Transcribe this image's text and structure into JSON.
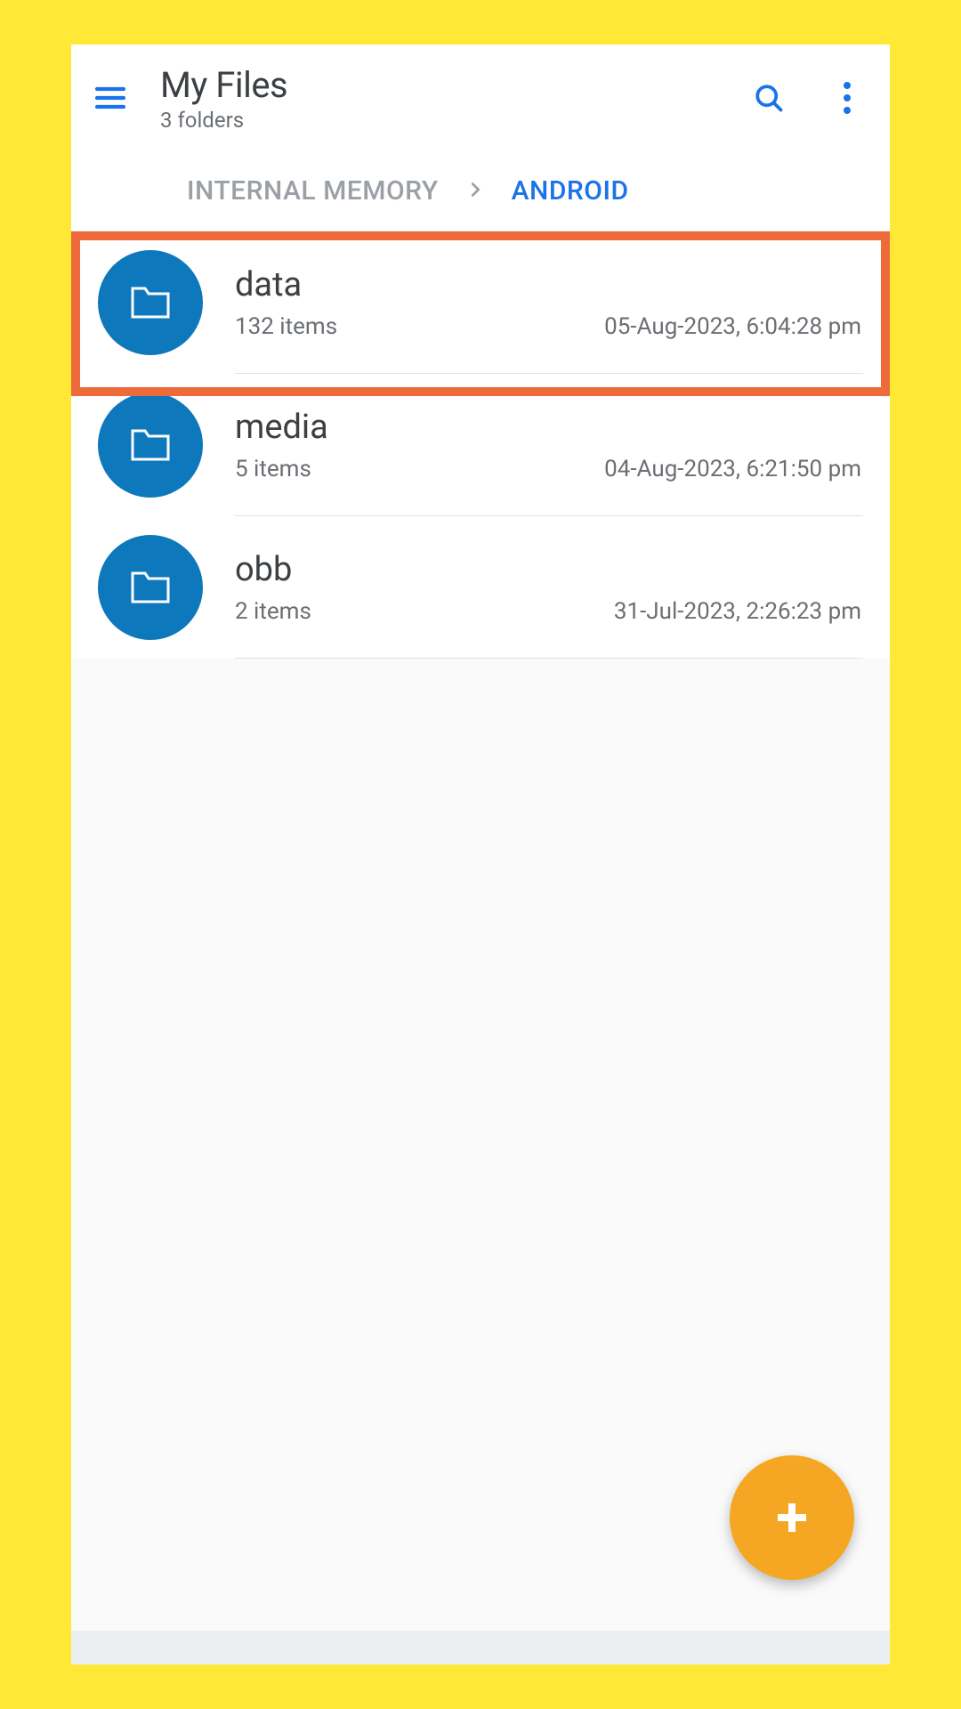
{
  "colors": {
    "accent": "#1a73e8",
    "folderCircle": "#0e78bc",
    "fab": "#f5a623",
    "highlight": "#ed6b3a"
  },
  "appbar": {
    "title": "My Files",
    "subtitle": "3 folders"
  },
  "breadcrumb": {
    "items": [
      {
        "label": "INTERNAL MEMORY",
        "active": false
      },
      {
        "label": "ANDROID",
        "active": true
      }
    ]
  },
  "folders": [
    {
      "name": "data",
      "items": "132 items",
      "date": "05-Aug-2023, 6:04:28 pm",
      "highlighted": true
    },
    {
      "name": "media",
      "items": "5 items",
      "date": "04-Aug-2023, 6:21:50 pm",
      "highlighted": false
    },
    {
      "name": "obb",
      "items": "2 items",
      "date": "31-Jul-2023, 2:26:23 pm",
      "highlighted": false
    }
  ]
}
